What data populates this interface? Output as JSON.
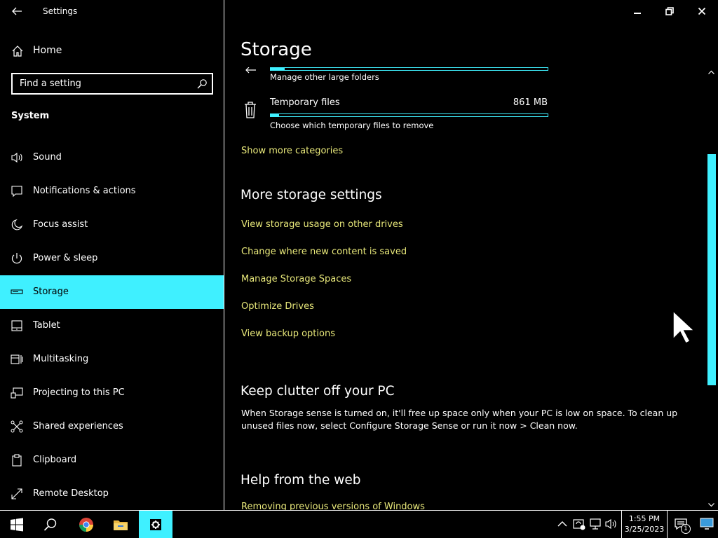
{
  "window": {
    "title": "Settings"
  },
  "sidebar": {
    "home_label": "Home",
    "search_placeholder": "Find a setting",
    "section_title": "System",
    "items": [
      {
        "label": "Sound",
        "icon": "speaker-icon",
        "active": false
      },
      {
        "label": "Notifications & actions",
        "icon": "notification-icon",
        "active": false
      },
      {
        "label": "Focus assist",
        "icon": "moon-icon",
        "active": false
      },
      {
        "label": "Power & sleep",
        "icon": "power-icon",
        "active": false
      },
      {
        "label": "Storage",
        "icon": "storage-icon",
        "active": true
      },
      {
        "label": "Tablet",
        "icon": "tablet-icon",
        "active": false
      },
      {
        "label": "Multitasking",
        "icon": "multitasking-icon",
        "active": false
      },
      {
        "label": "Projecting to this PC",
        "icon": "projecting-icon",
        "active": false
      },
      {
        "label": "Shared experiences",
        "icon": "shared-icon",
        "active": false
      },
      {
        "label": "Clipboard",
        "icon": "clipboard-icon",
        "active": false
      },
      {
        "label": "Remote Desktop",
        "icon": "remote-desktop-icon",
        "active": false
      }
    ]
  },
  "main": {
    "title": "Storage",
    "categories": [
      {
        "name": "",
        "size": "",
        "description": "Manage other large folders",
        "usage_fraction": 0.05
      },
      {
        "name": "Temporary files",
        "size": "861 MB",
        "description": "Choose which temporary files to remove",
        "usage_fraction": 0.03
      }
    ],
    "show_more_link": "Show more categories",
    "more_settings": {
      "heading": "More storage settings",
      "links": [
        "View storage usage on other drives",
        "Change where new content is saved",
        "Manage Storage Spaces",
        "Optimize Drives",
        "View backup options"
      ]
    },
    "clutter": {
      "heading": "Keep clutter off your PC",
      "text": "When Storage sense is turned on, it'll free up space only when your PC is low on space. To clean up unused files now, select Configure Storage Sense or run it now > Clean now."
    },
    "help": {
      "heading": "Help from the web",
      "link": "Removing previous versions of Windows"
    },
    "scroll_position": 0.4
  },
  "taskbar": {
    "apps": [
      "start-icon",
      "search-icon",
      "chrome-icon",
      "file-explorer-icon",
      "settings-icon"
    ],
    "active_app": "settings-icon",
    "clock": {
      "time": "1:55 PM",
      "date": "3/25/2023"
    },
    "notification_count": "1"
  },
  "colors": {
    "accent": "#3ff0ff",
    "link": "#e8e87a",
    "background": "#000000",
    "text": "#ffffff"
  }
}
